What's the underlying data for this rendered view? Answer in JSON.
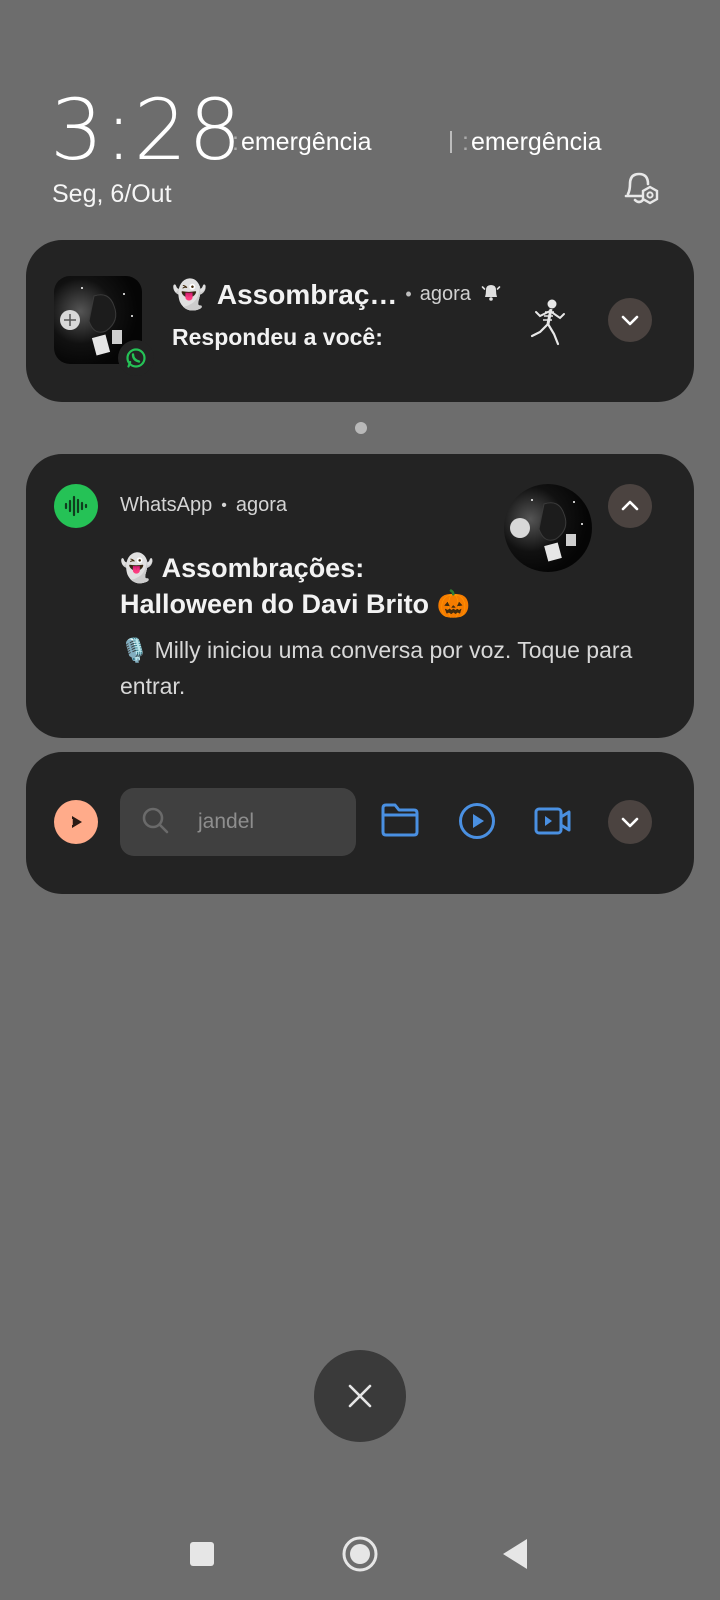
{
  "status": {
    "time": "3:28",
    "date": "Seg, 6/Out",
    "emergency_1": "emergência",
    "emergency_2": "emergência"
  },
  "notification_1": {
    "emoji": "👻",
    "title": "Assombraç…",
    "separator": "•",
    "time": "agora",
    "body": "Respondeu a você:",
    "app_badge_icon": "whatsapp-icon",
    "sticker_icon": "skeleton-icon"
  },
  "notification_2": {
    "app_icon": "voice-chat-icon",
    "app_name": "WhatsApp",
    "separator": "•",
    "time": "agora",
    "title_emoji": "👻",
    "title_line1": "Assombrações:",
    "title_line2": "Halloween do Davi Brito",
    "title_line2_emoji": "🎃",
    "body_emoji": "🎙️",
    "body": "Milly iniciou uma conversa por voz. Toque para entrar.",
    "accent": "#25c256"
  },
  "notification_3": {
    "app_icon": "player-icon",
    "search_placeholder": "jandel",
    "actions": [
      "folder-icon",
      "play-circle-icon",
      "video-icon"
    ],
    "accent": "#ffab8a",
    "action_color": "#4a90e2"
  },
  "nav": {
    "recents": "square-icon",
    "home": "circle-icon",
    "back": "triangle-back-icon"
  }
}
